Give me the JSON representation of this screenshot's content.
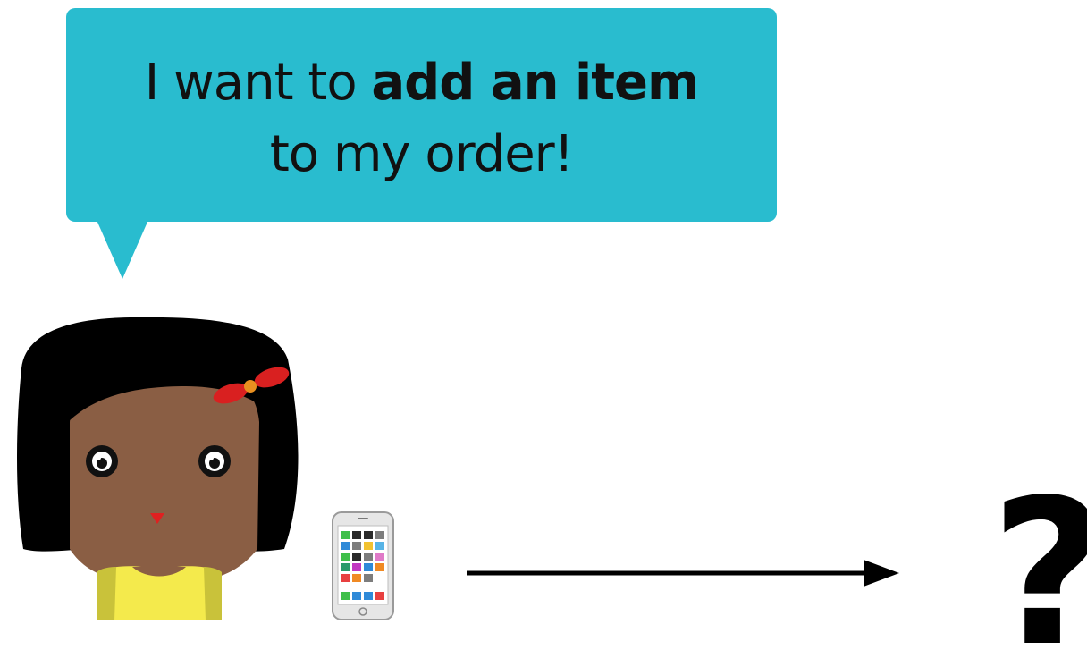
{
  "speech_bubble": {
    "prefix": "I want to ",
    "emphasis": "add an item",
    "line2": "to my order!",
    "color": "#29bccf"
  },
  "icons": {
    "person": "girl-avatar-icon",
    "device": "mobile-phone-icon",
    "flow": "right-arrow-icon"
  },
  "unknown_target": "?"
}
